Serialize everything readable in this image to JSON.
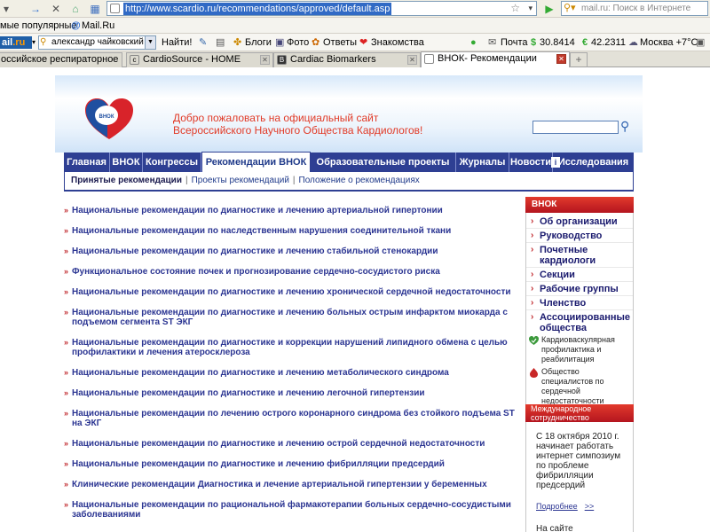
{
  "browser": {
    "url": "http://www.scardio.ru/recommendations/approved/default.asp",
    "search_placeholder": "mail.ru: Поиск в Интернете",
    "bookmarks": [
      "мые популярные",
      "Mail.Ru"
    ],
    "mail_toolbar": {
      "logo_prefix": "ail",
      "logo_suffix": ".ru",
      "search_value": "александр чайковский",
      "find_label": "Найти!",
      "links": [
        "Блоги",
        "Фото",
        "Ответы",
        "Знакомства"
      ],
      "mail_label": "Почта",
      "usd": "30.8414",
      "eur": "42.2311",
      "weather": "Москва +7°С"
    },
    "tabs": [
      {
        "title": "оссийское респираторное ...",
        "active": false
      },
      {
        "title": "CardioSource - HOME",
        "active": false
      },
      {
        "title": "Cardiac Biomarkers",
        "active": false
      },
      {
        "title": "ВНОК- Рекомендации",
        "active": true
      }
    ],
    "new_tab": "+"
  },
  "site": {
    "logo_text": "ВНОК",
    "welcome_line1": "Добро пожаловать на официальный сайт",
    "welcome_line2": "Всероссийского Научного Общества Кардиологов!",
    "menu": [
      {
        "label": "Главная",
        "active": false
      },
      {
        "label": "ВНОК",
        "active": false
      },
      {
        "label": "Конгрессы",
        "active": false
      },
      {
        "label": "Рекомендации ВНОК",
        "active": true
      },
      {
        "label": "Образовательные проекты",
        "active": false
      },
      {
        "label": "Журналы",
        "active": false
      },
      {
        "label": "Новости",
        "active": false
      },
      {
        "label": "Исследования",
        "active": false
      }
    ],
    "submenu": {
      "selected": "Принятые рекомендации",
      "sep": "|",
      "items": [
        "Проекты рекомендаций",
        "Положение о рекомендациях"
      ]
    },
    "recommendations": [
      "Национальные рекомендации по диагностике и лечению артериальной гипертонии",
      "Национальные рекомендации по наследственным нарушения соединительной ткани",
      "Национальные рекомендации по диагностике и лечению стабильной стенокардии",
      "Функциональное состояние почек и прогнозирование сердечно-сосудистого риска",
      "Национальные рекомендации по диагностике и лечению хронической сердечной недостаточности",
      "Национальные рекомендации по диагностике и лечению больных острым инфарктом миокарда с подъемом сегмента ST ЭКГ",
      "Национальные рекомендации по диагностике и коррекции нарушений липидного обмена с целью профилактики и лечения атеросклероза",
      "Национальные рекомендации по диагностике и лечению метаболического синдрома",
      "Национальные рекомендации по диагностике и лечению легочной гипертензии",
      "Национальные рекомендации по лечению острого коронарного синдрома без стойкого подъема ST на ЭКГ",
      "Национальные рекомендации по диагностике и лечению острой сердечной недостаточности",
      "Национальные рекомендации по диагностике и лечению фибрилляции предсердий",
      "Клинические рекомендации Диагностика и лечение артериальной гипертензии у беременных",
      "Национальные рекомендации по рациональной фармакотерапии больных сердечно-сосудистыми заболеваниями"
    ],
    "sidebar": {
      "title": "ВНОК",
      "items": [
        "Об организации",
        "Руководство",
        "Почетные кардиологи",
        "Секции",
        "Рабочие группы",
        "Членство",
        "Ассоциированные общества"
      ],
      "subitems": [
        "Кардиоваскулярная профилактика и реабилитация",
        "Общество специалистов по сердечной недостаточности"
      ]
    },
    "intl": {
      "title": "Международное сотрудничество",
      "text": "С 18 октября 2010 г. начинает работать интернет симпозиум по проблеме фибрилляции предсердий",
      "more": "Подробнее",
      "arrows": ">>",
      "tail": "На сайте"
    }
  }
}
